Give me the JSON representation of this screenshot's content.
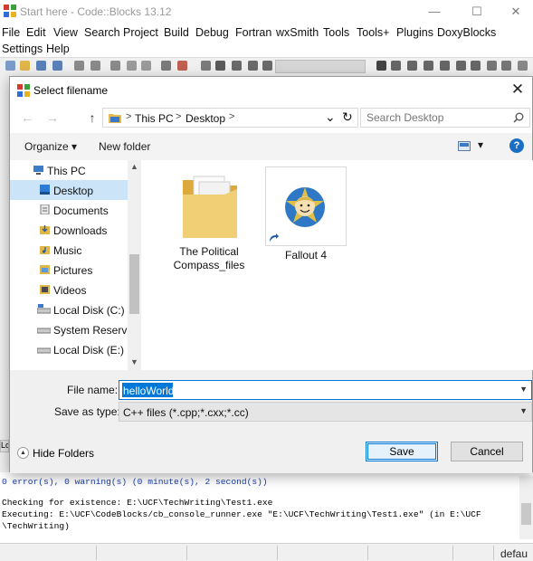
{
  "app": {
    "title": "Start here - Code::Blocks 13.12",
    "window_controls": {
      "minimize": "—",
      "maximize": "☐",
      "close": "✕"
    },
    "menu_row1": [
      "File",
      "Edit",
      "View",
      "Search",
      "Project",
      "Build",
      "Debug",
      "Fortran",
      "wxSmith",
      "Tools",
      "Tools+",
      "Plugins",
      "DoxyBlocks"
    ],
    "menu_row2": [
      "Settings",
      "Help"
    ],
    "log_lines": [
      "0 error(s), 0 warning(s) (0 minute(s), 2 second(s))",
      "",
      "Checking for existence: E:\\UCF\\TechWriting\\Test1.exe",
      "Executing: E:\\UCF\\CodeBlocks/cb_console_runner.exe \"E:\\UCF\\TechWriting\\Test1.exe\" (in E:\\UCF",
      "\\TechWriting)"
    ],
    "status_text": "defau",
    "left_tab": "Lo"
  },
  "dialog": {
    "title": "Select filename",
    "close": "✕",
    "nav": {
      "back": "←",
      "forward": "→",
      "up": "↑",
      "dropdown": "⌄",
      "refresh": "↻"
    },
    "breadcrumbs": [
      "This PC",
      "Desktop"
    ],
    "search_placeholder": "Search Desktop",
    "organize": "Organize ▾",
    "new_folder": "New folder",
    "view_dropdown": "▾",
    "help": "?",
    "tree": [
      {
        "label": "This PC",
        "icon": "computer-icon"
      },
      {
        "label": "Desktop",
        "icon": "desktop-icon",
        "selected": true
      },
      {
        "label": "Documents",
        "icon": "documents-icon"
      },
      {
        "label": "Downloads",
        "icon": "downloads-icon"
      },
      {
        "label": "Music",
        "icon": "music-icon"
      },
      {
        "label": "Pictures",
        "icon": "pictures-icon"
      },
      {
        "label": "Videos",
        "icon": "videos-icon"
      },
      {
        "label": "Local Disk (C:)",
        "icon": "drive-icon"
      },
      {
        "label": "System Reserved",
        "icon": "drive-icon"
      },
      {
        "label": "Local Disk (E:)",
        "icon": "drive-icon"
      }
    ],
    "files": [
      {
        "line1": "The Political",
        "line2": "Compass_files",
        "type": "folder"
      },
      {
        "line1": "Fallout 4",
        "line2": "",
        "type": "shortcut"
      }
    ],
    "file_name_label": "File name:",
    "file_name_value": "helloWorld",
    "save_type_label": "Save as type:",
    "save_type_value": "C++ files (*.cpp;*.cxx;*.cc)",
    "hide_folders": "Hide Folders",
    "save_button": "Save",
    "cancel_button": "Cancel"
  }
}
